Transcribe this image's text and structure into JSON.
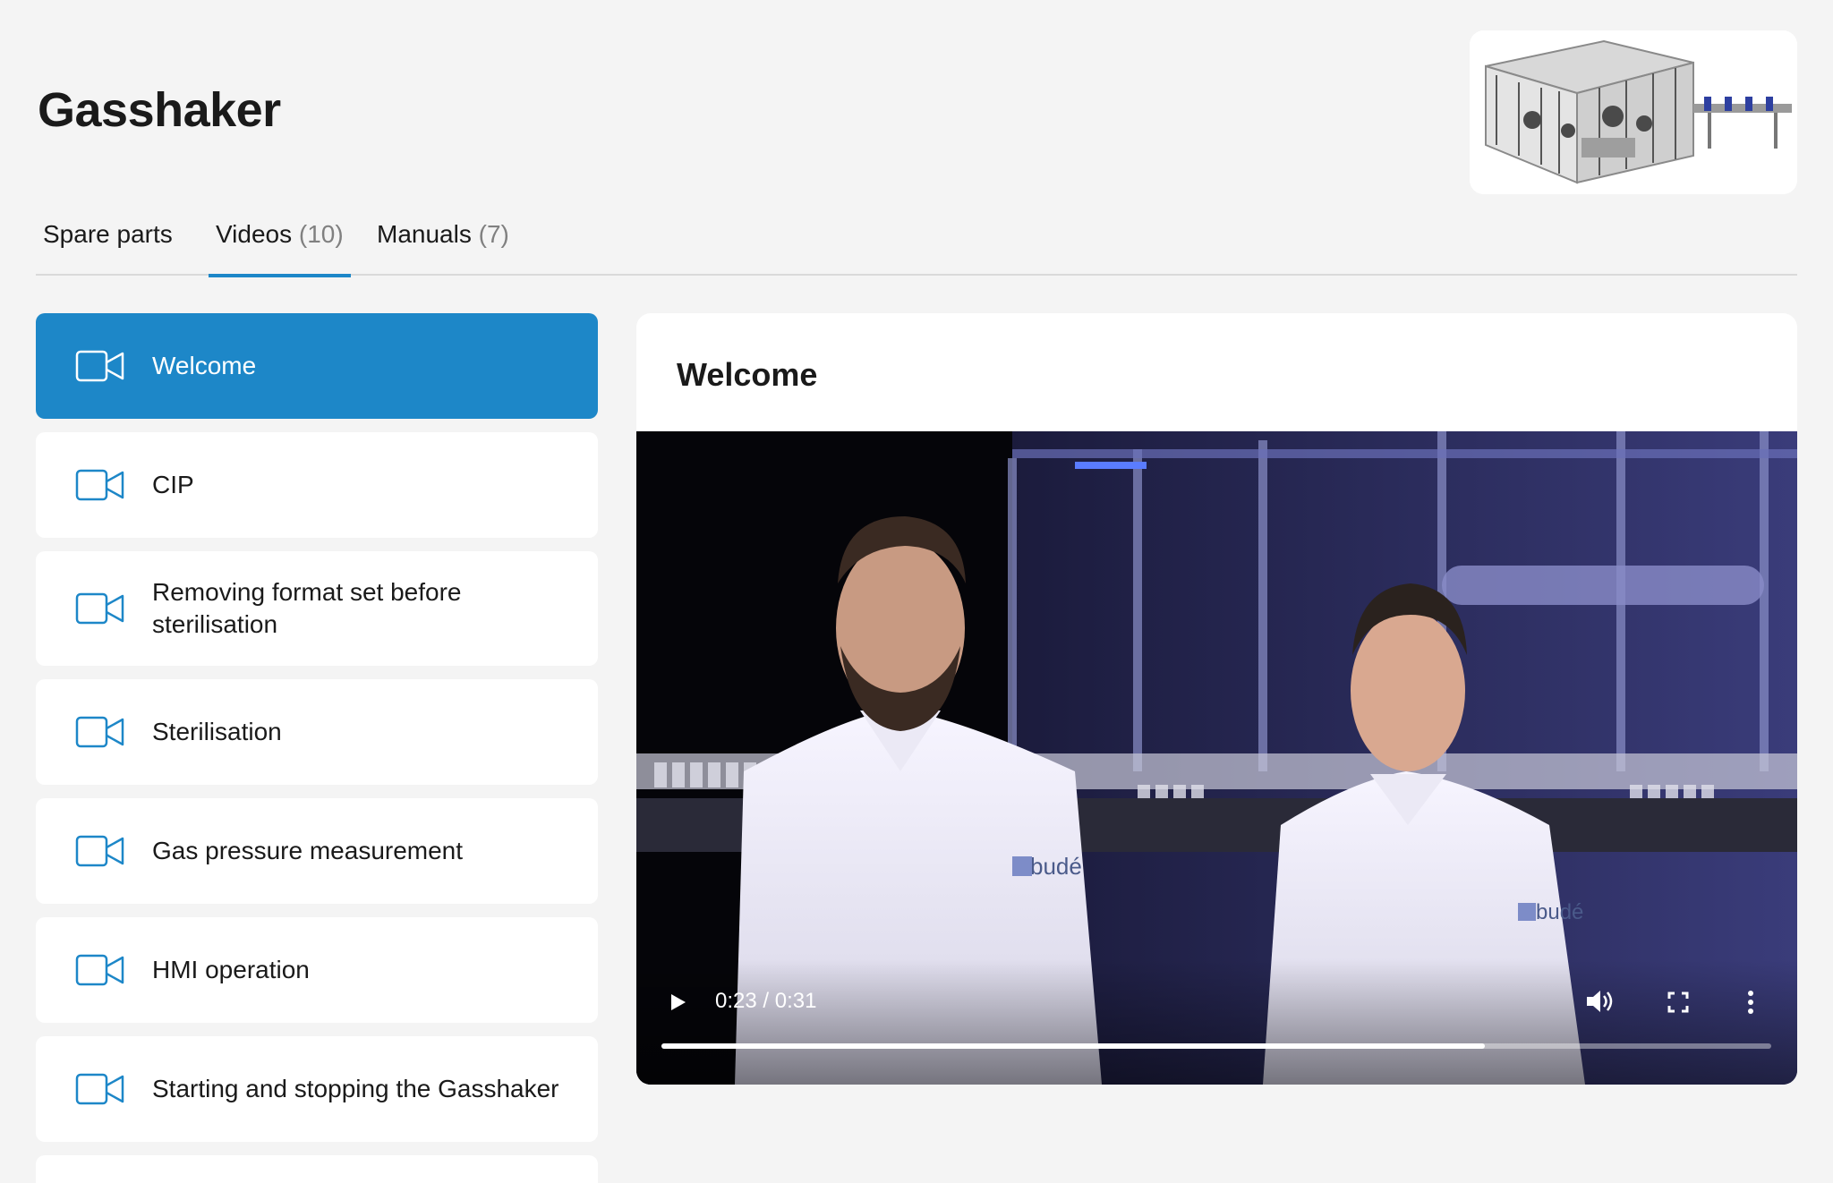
{
  "page": {
    "title": "Gasshaker"
  },
  "hero": {
    "alt_icon": "machine-image"
  },
  "tabs": [
    {
      "label": "Spare parts",
      "count": ""
    },
    {
      "label": "Videos",
      "count": "(10)"
    },
    {
      "label": "Manuals",
      "count": "(7)"
    }
  ],
  "active_tab": 1,
  "videos": [
    {
      "label": "Welcome",
      "active": true
    },
    {
      "label": "CIP"
    },
    {
      "label": "Removing format set before sterilisation"
    },
    {
      "label": "Sterilisation"
    },
    {
      "label": "Gas pressure measurement"
    },
    {
      "label": "HMI operation"
    },
    {
      "label": "Starting and stopping the Gasshaker"
    }
  ],
  "player": {
    "title": "Welcome",
    "time": "0:23 / 0:31",
    "progress_fraction": 0.742,
    "brand_text": "budé"
  },
  "colors": {
    "accent": "#1d87c8",
    "background": "#f4f4f4"
  }
}
